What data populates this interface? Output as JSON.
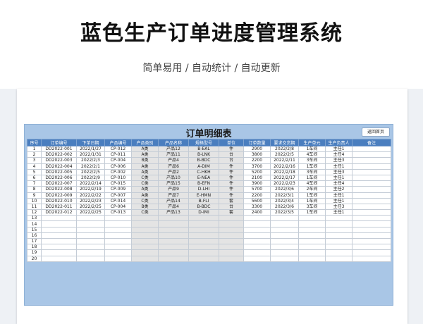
{
  "header": {
    "title": "蓝色生产订单进度管理系统",
    "subtitle": "简单易用 / 自动统计 / 自动更新"
  },
  "sheet": {
    "title": "订单明细表",
    "back_button": "返回首页",
    "columns": [
      "序号",
      "订单编号",
      "下单日期",
      "产品编号",
      "产品类别",
      "产品名称",
      "规格型号",
      "单位",
      "订单数量",
      "要求交货期",
      "生产单元",
      "生产负责人",
      "备注"
    ],
    "rows": [
      [
        "1",
        "DD2022-001",
        "2022/1/27",
        "CP-012",
        "A类",
        "产品12",
        "B-EAL",
        "件",
        "2900",
        "2022/2/8",
        "1车间",
        "主任1",
        ""
      ],
      [
        "2",
        "DD2022-002",
        "2022/1/31",
        "CP-011",
        "A类",
        "产品11",
        "B-LNK",
        "台",
        "3800",
        "2022/2/5",
        "4车间",
        "主任4",
        ""
      ],
      [
        "3",
        "DD2022-003",
        "2022/2/3",
        "CP-004",
        "B类",
        "产品4",
        "B-BDC",
        "台",
        "2200",
        "2022/2/11",
        "3车间",
        "主任3",
        ""
      ],
      [
        "4",
        "DD2022-004",
        "2022/2/1",
        "CP-006",
        "A类",
        "产品6",
        "A-DIM",
        "件",
        "3700",
        "2022/2/16",
        "1车间",
        "主任1",
        ""
      ],
      [
        "5",
        "DD2022-005",
        "2022/2/5",
        "CP-002",
        "A类",
        "产品2",
        "C-HKH",
        "件",
        "5200",
        "2022/2/18",
        "3车间",
        "主任3",
        ""
      ],
      [
        "6",
        "DD2022-006",
        "2022/2/9",
        "CP-010",
        "C类",
        "产品10",
        "E-NEA",
        "件",
        "2100",
        "2022/2/17",
        "1车间",
        "主任1",
        ""
      ],
      [
        "7",
        "DD2022-007",
        "2022/2/14",
        "CP-015",
        "C类",
        "产品15",
        "B-EFN",
        "件",
        "3900",
        "2022/2/23",
        "4车间",
        "主任4",
        ""
      ],
      [
        "8",
        "DD2022-008",
        "2022/2/19",
        "CP-009",
        "A类",
        "产品9",
        "D-LHI",
        "件",
        "5700",
        "2022/3/6",
        "2车间",
        "主任2",
        ""
      ],
      [
        "9",
        "DD2022-009",
        "2022/2/22",
        "CP-007",
        "A类",
        "产品7",
        "E-HMN",
        "件",
        "2200",
        "2022/3/1",
        "1车间",
        "主任1",
        ""
      ],
      [
        "10",
        "DD2022-010",
        "2022/2/23",
        "CP-014",
        "C类",
        "产品14",
        "B-FLI",
        "套",
        "5600",
        "2022/3/4",
        "1车间",
        "主任1",
        ""
      ],
      [
        "11",
        "DD2022-011",
        "2022/2/25",
        "CP-004",
        "B类",
        "产品4",
        "B-BDC",
        "台",
        "3300",
        "2022/3/6",
        "3车间",
        "主任3",
        ""
      ],
      [
        "12",
        "DD2022-012",
        "2022/2/25",
        "CP-013",
        "C类",
        "产品13",
        "D-IMI",
        "套",
        "2400",
        "2022/3/5",
        "1车间",
        "主任1",
        ""
      ],
      [
        "13",
        "",
        "",
        "",
        "",
        "",
        "",
        "",
        "",
        "",
        "",
        "",
        ""
      ],
      [
        "14",
        "",
        "",
        "",
        "",
        "",
        "",
        "",
        "",
        "",
        "",
        "",
        ""
      ],
      [
        "15",
        "",
        "",
        "",
        "",
        "",
        "",
        "",
        "",
        "",
        "",
        "",
        ""
      ],
      [
        "16",
        "",
        "",
        "",
        "",
        "",
        "",
        "",
        "",
        "",
        "",
        "",
        ""
      ],
      [
        "17",
        "",
        "",
        "",
        "",
        "",
        "",
        "",
        "",
        "",
        "",
        "",
        ""
      ],
      [
        "18",
        "",
        "",
        "",
        "",
        "",
        "",
        "",
        "",
        "",
        "",
        "",
        ""
      ],
      [
        "19",
        "",
        "",
        "",
        "",
        "",
        "",
        "",
        "",
        "",
        "",
        "",
        ""
      ],
      [
        "20",
        "",
        "",
        "",
        "",
        "",
        "",
        "",
        "",
        "",
        "",
        "",
        ""
      ]
    ]
  },
  "colors": {
    "header_fill": "#4a7ebf",
    "frame_fill": "#a9c6e6",
    "formula_cell_fill": "#e4e4e4"
  }
}
